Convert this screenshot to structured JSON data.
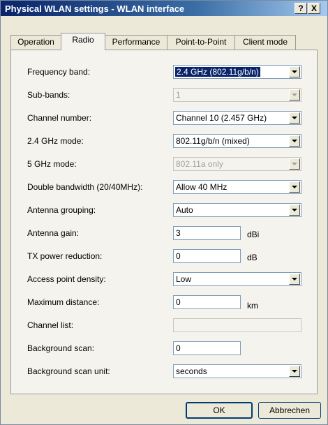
{
  "window": {
    "title": "Physical WLAN settings - WLAN interface",
    "help_label": "?",
    "close_label": "X"
  },
  "tabs": [
    {
      "label": "Operation"
    },
    {
      "label": "Radio"
    },
    {
      "label": "Performance"
    },
    {
      "label": "Point-to-Point"
    },
    {
      "label": "Client mode"
    }
  ],
  "fields": {
    "frequency_band": {
      "label": "Frequency band:",
      "value": "2.4 GHz (802.11g/b/n)"
    },
    "sub_bands": {
      "label": "Sub-bands:",
      "value": "1"
    },
    "channel_number": {
      "label": "Channel number:",
      "value": "Channel 10 (2.457 GHz)"
    },
    "mode_24": {
      "label": "2.4 GHz mode:",
      "value": "802.11g/b/n (mixed)"
    },
    "mode_5": {
      "label": "5 GHz mode:",
      "value": "802.11a only"
    },
    "double_bandwidth": {
      "label": "Double bandwidth (20/40MHz):",
      "value": "Allow 40 MHz"
    },
    "antenna_grouping": {
      "label": "Antenna grouping:",
      "value": "Auto"
    },
    "antenna_gain": {
      "label": "Antenna gain:",
      "value": "3",
      "unit": "dBi"
    },
    "tx_power_reduction": {
      "label": "TX power reduction:",
      "value": "0",
      "unit": "dB"
    },
    "ap_density": {
      "label": "Access point density:",
      "value": "Low"
    },
    "max_distance": {
      "label": "Maximum distance:",
      "value": "0",
      "unit": "km"
    },
    "channel_list": {
      "label": "Channel list:",
      "value": ""
    },
    "background_scan": {
      "label": "Background scan:",
      "value": "0"
    },
    "background_scan_unit": {
      "label": "Background scan unit:",
      "value": "seconds"
    }
  },
  "buttons": {
    "ok": "OK",
    "cancel": "Abbrechen"
  }
}
